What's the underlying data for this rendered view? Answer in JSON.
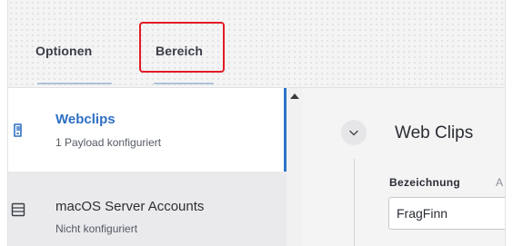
{
  "tabs": [
    {
      "label": "Optionen"
    },
    {
      "label": "Bereich"
    }
  ],
  "sidebar": {
    "items": [
      {
        "title": "Webclips",
        "subtitle": "1 Payload konfiguriert",
        "icon": "webclip-icon",
        "active": true
      },
      {
        "title": "macOS Server Accounts",
        "subtitle": "Nicht konfiguriert",
        "icon": "server-account-icon",
        "active": false
      }
    ]
  },
  "main": {
    "section_title": "Web Clips",
    "field": {
      "label": "Bezeichnung",
      "hint": "A",
      "value": "FragFinn"
    }
  },
  "colors": {
    "accent": "#2d6fc2",
    "highlight_border": "#e31b23",
    "tab_underline": "#aec2d9"
  }
}
